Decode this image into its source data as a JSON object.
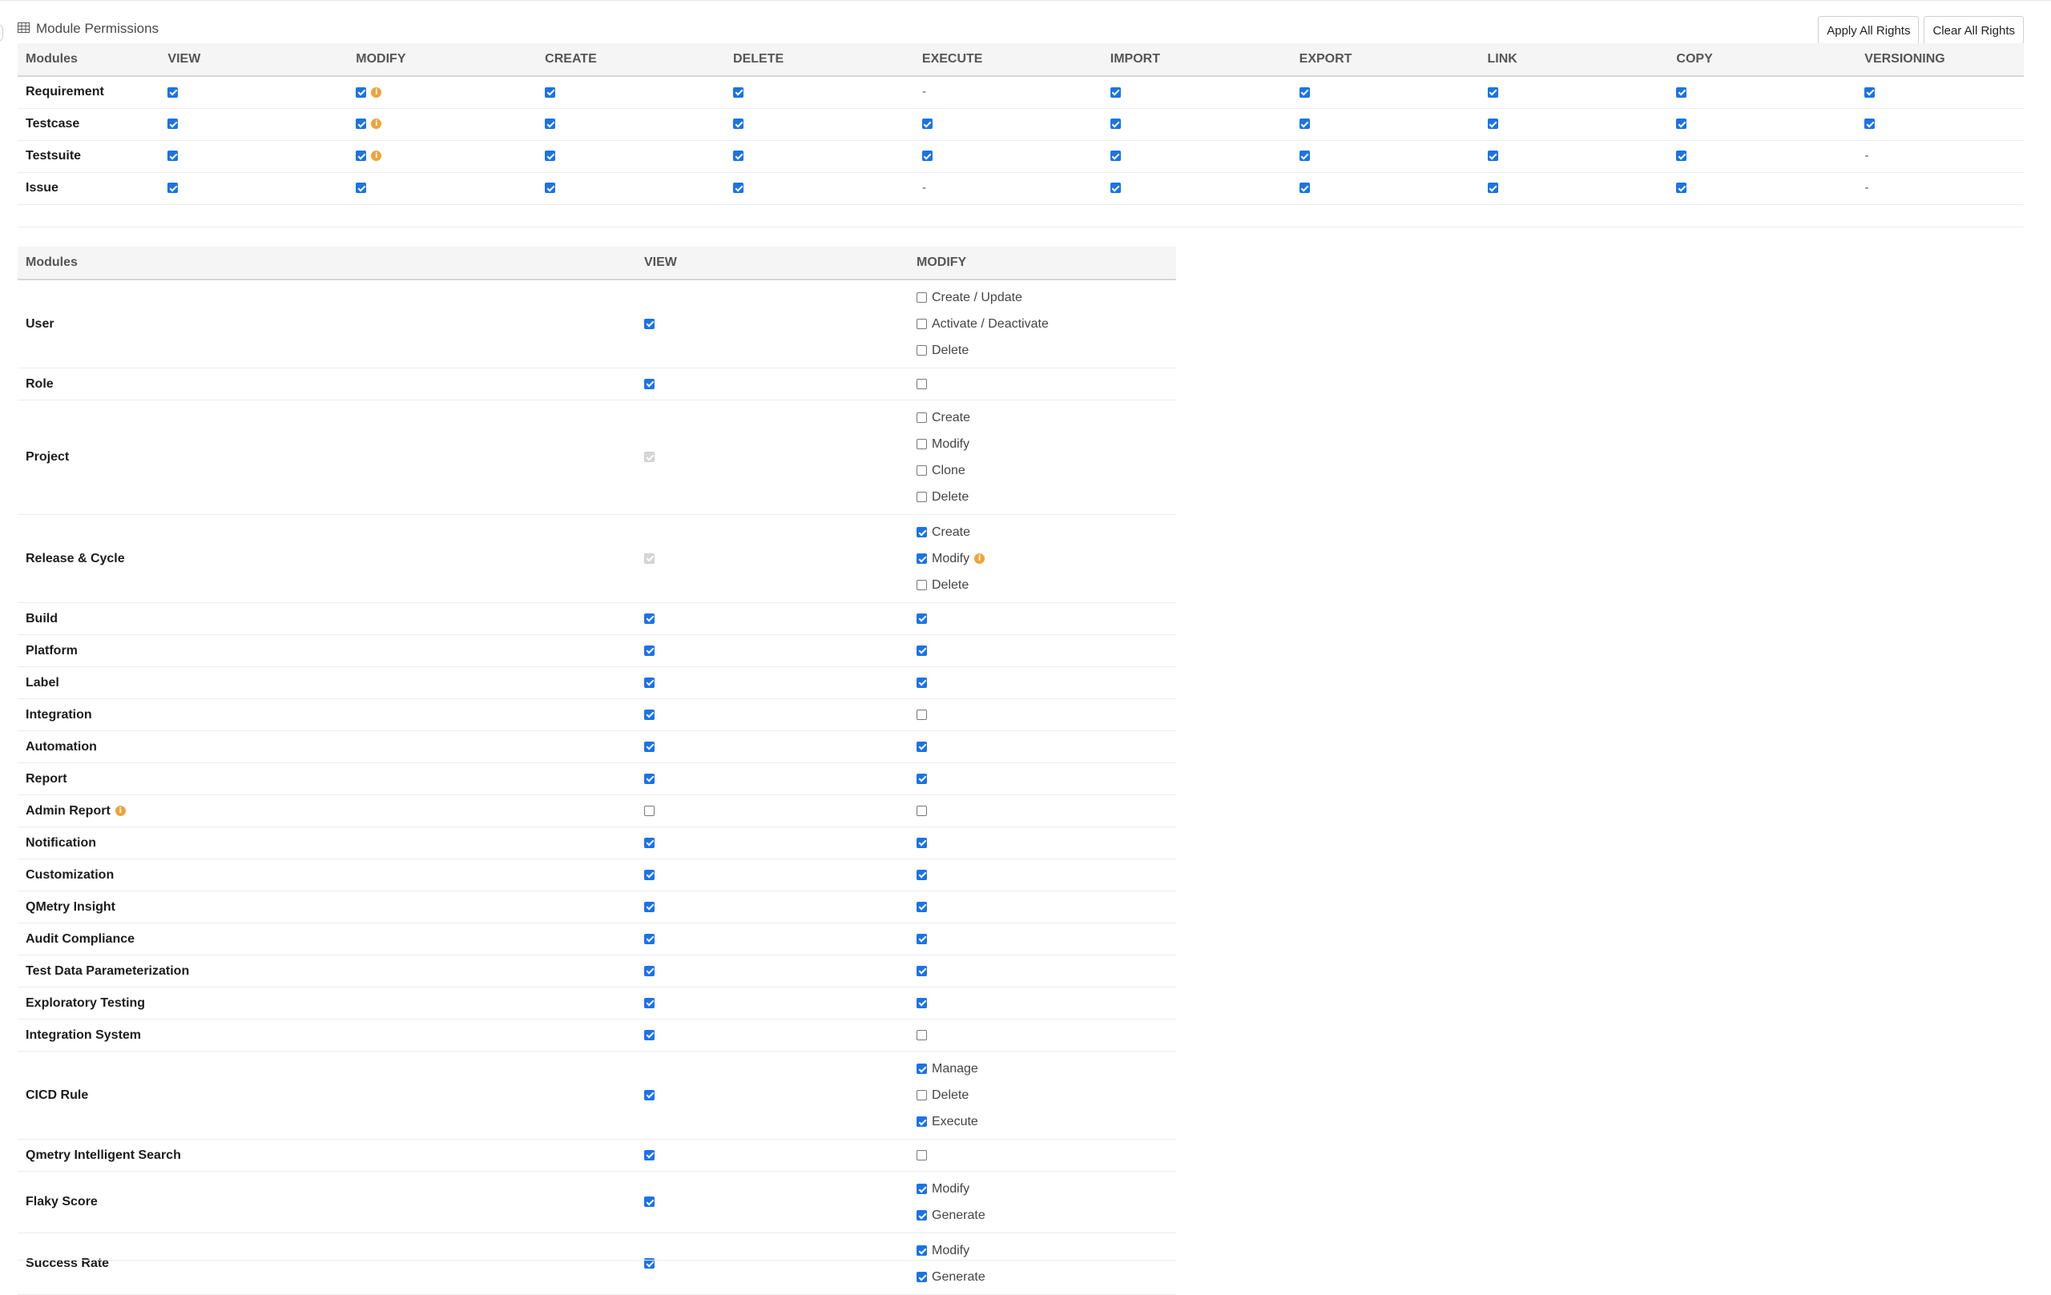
{
  "header": {
    "title": "Module Permissions",
    "icon": "table-icon",
    "apply_label": "Apply All Rights",
    "clear_label": "Clear All Rights"
  },
  "colors": {
    "accent": "#1a73e8",
    "info": "#f0a23c"
  },
  "permissions": {
    "columns": [
      "Modules",
      "VIEW",
      "MODIFY",
      "CREATE",
      "DELETE",
      "EXECUTE",
      "IMPORT",
      "EXPORT",
      "LINK",
      "COPY",
      "VERSIONING"
    ],
    "rows": [
      {
        "name": "Requirement",
        "cells": [
          {
            "checked": true
          },
          {
            "checked": true,
            "info": true
          },
          {
            "checked": true
          },
          {
            "checked": true
          },
          {
            "na": "-"
          },
          {
            "checked": true
          },
          {
            "checked": true
          },
          {
            "checked": true
          },
          {
            "checked": true
          },
          {
            "checked": true
          }
        ]
      },
      {
        "name": "Testcase",
        "cells": [
          {
            "checked": true
          },
          {
            "checked": true,
            "info": true
          },
          {
            "checked": true
          },
          {
            "checked": true
          },
          {
            "checked": true
          },
          {
            "checked": true
          },
          {
            "checked": true
          },
          {
            "checked": true
          },
          {
            "checked": true
          },
          {
            "checked": true
          }
        ]
      },
      {
        "name": "Testsuite",
        "cells": [
          {
            "checked": true
          },
          {
            "checked": true,
            "info": true
          },
          {
            "checked": true
          },
          {
            "checked": true
          },
          {
            "checked": true
          },
          {
            "checked": true
          },
          {
            "checked": true
          },
          {
            "checked": true
          },
          {
            "checked": true
          },
          {
            "na": "-"
          }
        ]
      },
      {
        "name": "Issue",
        "cells": [
          {
            "checked": true
          },
          {
            "checked": true
          },
          {
            "checked": true
          },
          {
            "checked": true
          },
          {
            "na": "-"
          },
          {
            "checked": true
          },
          {
            "checked": true
          },
          {
            "checked": true
          },
          {
            "checked": true
          },
          {
            "na": "-"
          }
        ]
      }
    ]
  },
  "admin": {
    "columns": [
      "Modules",
      "VIEW",
      "MODIFY"
    ],
    "rows": [
      {
        "name": "User",
        "view": {
          "checked": true
        },
        "modify": {
          "options": [
            {
              "label": "Create / Update",
              "checked": false
            },
            {
              "label": "Activate / Deactivate",
              "checked": false
            },
            {
              "label": "Delete",
              "checked": false
            }
          ]
        }
      },
      {
        "name": "Role",
        "view": {
          "checked": true
        },
        "modify": {
          "checked": false
        }
      },
      {
        "name": "Project",
        "view": {
          "checked": true,
          "disabled": true
        },
        "modify": {
          "options": [
            {
              "label": "Create",
              "checked": false
            },
            {
              "label": "Modify",
              "checked": false
            },
            {
              "label": "Clone",
              "checked": false
            },
            {
              "label": "Delete",
              "checked": false
            }
          ]
        }
      },
      {
        "name": "Release & Cycle",
        "view": {
          "checked": true,
          "disabled": true
        },
        "modify": {
          "options": [
            {
              "label": "Create",
              "checked": true
            },
            {
              "label": "Modify",
              "checked": true,
              "info": true
            },
            {
              "label": "Delete",
              "checked": false
            }
          ]
        }
      },
      {
        "name": "Build",
        "view": {
          "checked": true
        },
        "modify": {
          "checked": true
        }
      },
      {
        "name": "Platform",
        "view": {
          "checked": true
        },
        "modify": {
          "checked": true
        }
      },
      {
        "name": "Label",
        "view": {
          "checked": true
        },
        "modify": {
          "checked": true
        }
      },
      {
        "name": "Integration",
        "view": {
          "checked": true
        },
        "modify": {
          "checked": false
        }
      },
      {
        "name": "Automation",
        "view": {
          "checked": true
        },
        "modify": {
          "checked": true
        }
      },
      {
        "name": "Report",
        "view": {
          "checked": true
        },
        "modify": {
          "checked": true
        }
      },
      {
        "name": "Admin Report",
        "info": true,
        "view": {
          "checked": false
        },
        "modify": {
          "checked": false
        }
      },
      {
        "name": "Notification",
        "view": {
          "checked": true
        },
        "modify": {
          "checked": true
        }
      },
      {
        "name": "Customization",
        "view": {
          "checked": true
        },
        "modify": {
          "checked": true
        }
      },
      {
        "name": "QMetry Insight",
        "view": {
          "checked": true
        },
        "modify": {
          "checked": true
        }
      },
      {
        "name": "Audit Compliance",
        "view": {
          "checked": true
        },
        "modify": {
          "checked": true
        }
      },
      {
        "name": "Test Data Parameterization",
        "view": {
          "checked": true
        },
        "modify": {
          "checked": true
        }
      },
      {
        "name": "Exploratory Testing",
        "view": {
          "checked": true
        },
        "modify": {
          "checked": true
        }
      },
      {
        "name": "Integration System",
        "view": {
          "checked": true
        },
        "modify": {
          "checked": false
        }
      },
      {
        "name": "CICD Rule",
        "view": {
          "checked": true
        },
        "modify": {
          "options": [
            {
              "label": "Manage",
              "checked": true
            },
            {
              "label": "Delete",
              "checked": false
            },
            {
              "label": "Execute",
              "checked": true
            }
          ]
        }
      },
      {
        "name": "Qmetry Intelligent Search",
        "view": {
          "checked": true
        },
        "modify": {
          "checked": false
        }
      },
      {
        "name": "Flaky Score",
        "view": {
          "checked": true
        },
        "modify": {
          "options": [
            {
              "label": "Modify",
              "checked": true
            },
            {
              "label": "Generate",
              "checked": true
            }
          ]
        }
      },
      {
        "name": "Success Rate",
        "view": {
          "checked": true
        },
        "modify": {
          "options": [
            {
              "label": "Modify",
              "checked": true
            },
            {
              "label": "Generate",
              "checked": true
            }
          ]
        }
      }
    ]
  }
}
